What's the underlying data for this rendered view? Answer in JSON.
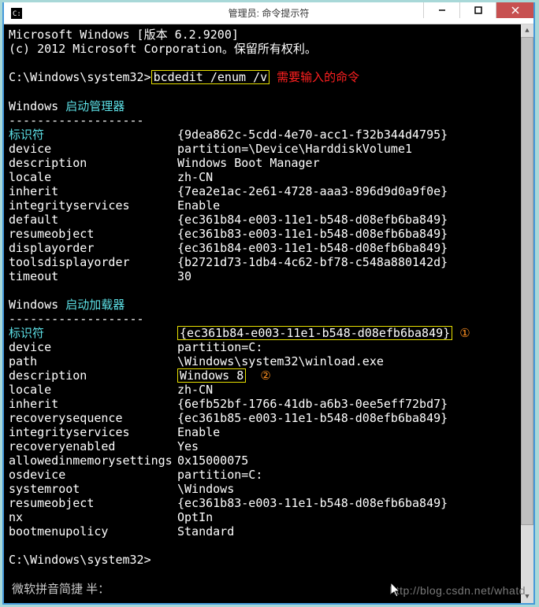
{
  "window": {
    "title": "管理员: 命令提示符"
  },
  "header": {
    "line1": "Microsoft Windows [版本 6.2.9200]",
    "line2": "(c) 2012 Microsoft Corporation。保留所有权利。"
  },
  "prompt": {
    "path": "C:\\Windows\\system32>",
    "command": "bcdedit /enum /v",
    "annotation": "需要输入的命令"
  },
  "bootmgr": {
    "title_prefix": "Windows ",
    "title_cn": "启动管理器",
    "divider": "-------------------",
    "id_label": "标识符",
    "id_value": "{9dea862c-5cdd-4e70-acc1-f32b344d4795}",
    "rows": [
      {
        "k": "device",
        "v": "partition=\\Device\\HarddiskVolume1"
      },
      {
        "k": "description",
        "v": "Windows Boot Manager"
      },
      {
        "k": "locale",
        "v": "zh-CN"
      },
      {
        "k": "inherit",
        "v": "{7ea2e1ac-2e61-4728-aaa3-896d9d0a9f0e}"
      },
      {
        "k": "integrityservices",
        "v": "Enable"
      },
      {
        "k": "default",
        "v": "{ec361b84-e003-11e1-b548-d08efb6ba849}"
      },
      {
        "k": "resumeobject",
        "v": "{ec361b83-e003-11e1-b548-d08efb6ba849}"
      },
      {
        "k": "displayorder",
        "v": "{ec361b84-e003-11e1-b548-d08efb6ba849}"
      },
      {
        "k": "toolsdisplayorder",
        "v": "{b2721d73-1db4-4c62-bf78-c548a880142d}"
      },
      {
        "k": "timeout",
        "v": "30"
      }
    ]
  },
  "loader": {
    "title_prefix": "Windows ",
    "title_cn": "启动加载器",
    "divider": "-------------------",
    "id_label": "标识符",
    "id_value": "{ec361b84-e003-11e1-b548-d08efb6ba849}",
    "id_marker": "①",
    "desc_marker": "②",
    "rows_before": [
      {
        "k": "device",
        "v": "partition=C:"
      },
      {
        "k": "path",
        "v": "\\Windows\\system32\\winload.exe"
      }
    ],
    "desc_k": "description",
    "desc_v": "Windows 8",
    "rows_after": [
      {
        "k": "locale",
        "v": "zh-CN"
      },
      {
        "k": "inherit",
        "v": "{6efb52bf-1766-41db-a6b3-0ee5eff72bd7}"
      },
      {
        "k": "recoverysequence",
        "v": "{ec361b85-e003-11e1-b548-d08efb6ba849}"
      },
      {
        "k": "integrityservices",
        "v": "Enable"
      },
      {
        "k": "recoveryenabled",
        "v": "Yes"
      },
      {
        "k": "allowedinmemorysettings",
        "v": "0x15000075"
      },
      {
        "k": "osdevice",
        "v": "partition=C:"
      },
      {
        "k": "systemroot",
        "v": "\\Windows"
      },
      {
        "k": "resumeobject",
        "v": "{ec361b83-e003-11e1-b548-d08efb6ba849}"
      },
      {
        "k": "nx",
        "v": "OptIn"
      },
      {
        "k": "bootmenupolicy",
        "v": "Standard"
      }
    ]
  },
  "prompt2": "C:\\Windows\\system32>",
  "ime": "微软拼音简捷 半：",
  "watermark": "http://blog.csdn.net/whatd"
}
